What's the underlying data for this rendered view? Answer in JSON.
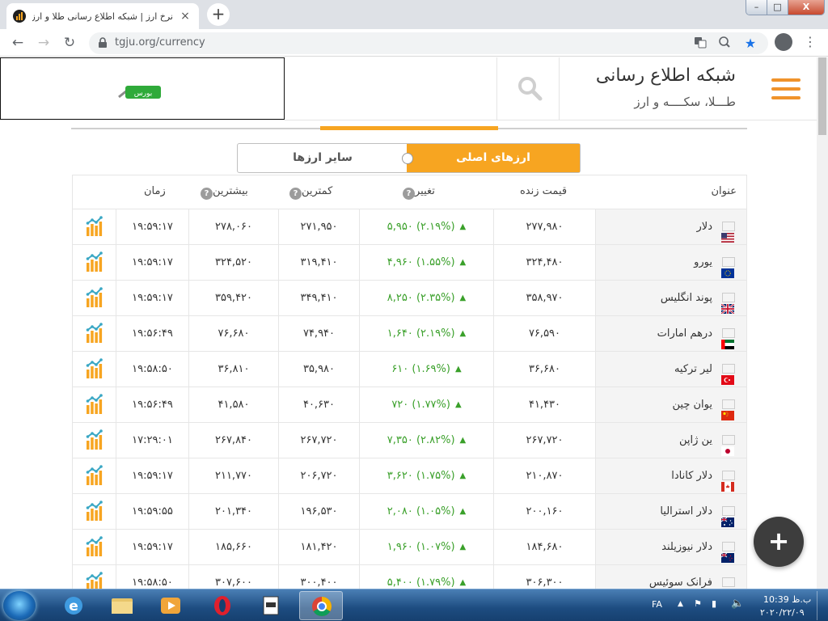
{
  "browser": {
    "tab_title": "نرخ ارز | شبکه اطلاع رسانی طلا و ارز",
    "tab_close": "×",
    "new_tab": "+",
    "url": "tgju.org/currency",
    "window_controls": {
      "minimize": "–",
      "maximize": "□",
      "close": "X"
    }
  },
  "site": {
    "brand_title": "شبکه اطلاع رسانی",
    "brand_subtitle": "طـــلا، سکــــه و ارز",
    "bourse_logo_text": "بورس"
  },
  "tabs": {
    "active": "ارزهای اصلی",
    "inactive": "سایر ارزها"
  },
  "table": {
    "headers": {
      "title": "عنوان",
      "live_price": "قیمت زنده",
      "change": "تغییر",
      "low": "کمترین",
      "high": "بیشترین",
      "time": "زمان"
    },
    "help_glyph": "?",
    "up_arrow": "▲",
    "rows": [
      {
        "flag": "us",
        "name": "دلار",
        "price": "۲۷۷,۹۸۰",
        "change": "۵,۹۵۰ (۲.۱۹%)",
        "low": "۲۷۱,۹۵۰",
        "high": "۲۷۸,۰۶۰",
        "time": "۱۹:۵۹:۱۷"
      },
      {
        "flag": "eu",
        "name": "یورو",
        "price": "۳۲۴,۴۸۰",
        "change": "۴,۹۶۰ (۱.۵۵%)",
        "low": "۳۱۹,۴۱۰",
        "high": "۳۲۴,۵۲۰",
        "time": "۱۹:۵۹:۱۷"
      },
      {
        "flag": "gb",
        "name": "پوند انگلیس",
        "price": "۳۵۸,۹۷۰",
        "change": "۸,۲۵۰ (۲.۳۵%)",
        "low": "۳۴۹,۴۱۰",
        "high": "۳۵۹,۴۲۰",
        "time": "۱۹:۵۹:۱۷"
      },
      {
        "flag": "ae",
        "name": "درهم امارات",
        "price": "۷۶,۵۹۰",
        "change": "۱,۶۴۰ (۲.۱۹%)",
        "low": "۷۴,۹۴۰",
        "high": "۷۶,۶۸۰",
        "time": "۱۹:۵۶:۴۹"
      },
      {
        "flag": "tr",
        "name": "لیر ترکیه",
        "price": "۳۶,۶۸۰",
        "change": "۶۱۰ (۱.۶۹%)",
        "low": "۳۵,۹۸۰",
        "high": "۳۶,۸۱۰",
        "time": "۱۹:۵۸:۵۰"
      },
      {
        "flag": "cn",
        "name": "یوان چین",
        "price": "۴۱,۴۳۰",
        "change": "۷۲۰ (۱.۷۷%)",
        "low": "۴۰,۶۳۰",
        "high": "۴۱,۵۸۰",
        "time": "۱۹:۵۶:۴۹"
      },
      {
        "flag": "jp",
        "name": "ین ژاپن",
        "price": "۲۶۷,۷۲۰",
        "change": "۷,۳۵۰ (۲.۸۲%)",
        "low": "۲۶۷,۷۲۰",
        "high": "۲۶۷,۸۴۰",
        "time": "۱۷:۲۹:۰۱"
      },
      {
        "flag": "ca",
        "name": "دلار کانادا",
        "price": "۲۱۰,۸۷۰",
        "change": "۳,۶۲۰ (۱.۷۵%)",
        "low": "۲۰۶,۷۲۰",
        "high": "۲۱۱,۷۷۰",
        "time": "۱۹:۵۹:۱۷"
      },
      {
        "flag": "au",
        "name": "دلار استرالیا",
        "price": "۲۰۰,۱۶۰",
        "change": "۲,۰۸۰ (۱.۰۵%)",
        "low": "۱۹۶,۵۳۰",
        "high": "۲۰۱,۳۴۰",
        "time": "۱۹:۵۹:۵۵"
      },
      {
        "flag": "nz",
        "name": "دلار نیوزیلند",
        "price": "۱۸۴,۶۸۰",
        "change": "۱,۹۶۰ (۱.۰۷%)",
        "low": "۱۸۱,۴۲۰",
        "high": "۱۸۵,۶۶۰",
        "time": "۱۹:۵۹:۱۷"
      },
      {
        "flag": "ch",
        "name": "فرانک سوئیس",
        "price": "۳۰۶,۳۰۰",
        "change": "۵,۴۰۰ (۱.۷۹%)",
        "low": "۳۰۰,۴۰۰",
        "high": "۳۰۷,۶۰۰",
        "time": "۱۹:۵۸:۵۰"
      }
    ]
  },
  "fab_label": "+",
  "taskbar": {
    "language": "FA",
    "time": "10:39 ب.ظ",
    "date": "۲۰۲۰/۲۲/۰۹"
  },
  "colors": {
    "accent": "#f7a521",
    "positive": "#3aa02a",
    "menu": "#f0932b"
  }
}
